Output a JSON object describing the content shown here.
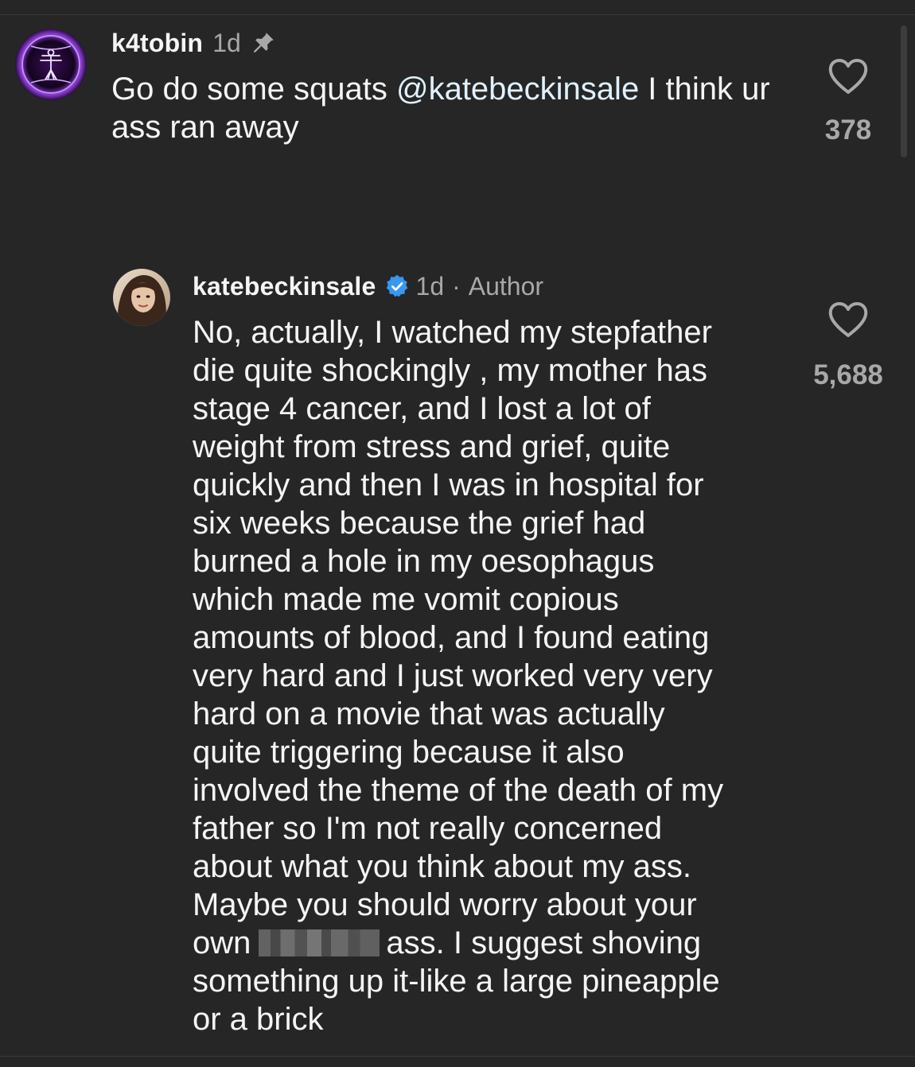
{
  "comments": [
    {
      "username": "k4tobin",
      "time": "1d",
      "pinned": true,
      "text_before_mention": "Go do some squats ",
      "mention": "@katebeckinsale",
      "text_after_mention": " I think ur ass ran away",
      "likes": "378",
      "avatar_icon": "vitruvian-man-icon"
    },
    {
      "username": "katebeckinsale",
      "verified": true,
      "time": "1d",
      "separator": "·",
      "author_label": "Author",
      "likes": "5,688",
      "lines": [
        "No, actually,  I watched my stepfather",
        "die quite shockingly , my mother has",
        "stage 4 cancer, and I lost a lot of",
        "weight from stress and grief, quite",
        "quickly and then I was in hospital for",
        "six weeks because the grief had",
        "burned a hole in my oesophagus",
        "which made me vomit copious",
        "amounts of blood, and I found eating",
        "very hard and I just worked very very",
        "hard on a movie that was actually",
        "quite triggering because it also",
        "involved the theme of the death of my",
        "father so I'm not really concerned",
        "about what you think about my ass.",
        "Maybe you should worry about your"
      ],
      "line_own": "own",
      "line_after_redaction": "ass. I suggest shoving",
      "closing_lines": [
        "something up it-like a large pineapple",
        "or a brick"
      ]
    }
  ],
  "colors": {
    "background": "#262626",
    "primary_text": "#f5f5f5",
    "secondary_text": "#a8a8a8",
    "verified_blue": "#3897f0"
  }
}
